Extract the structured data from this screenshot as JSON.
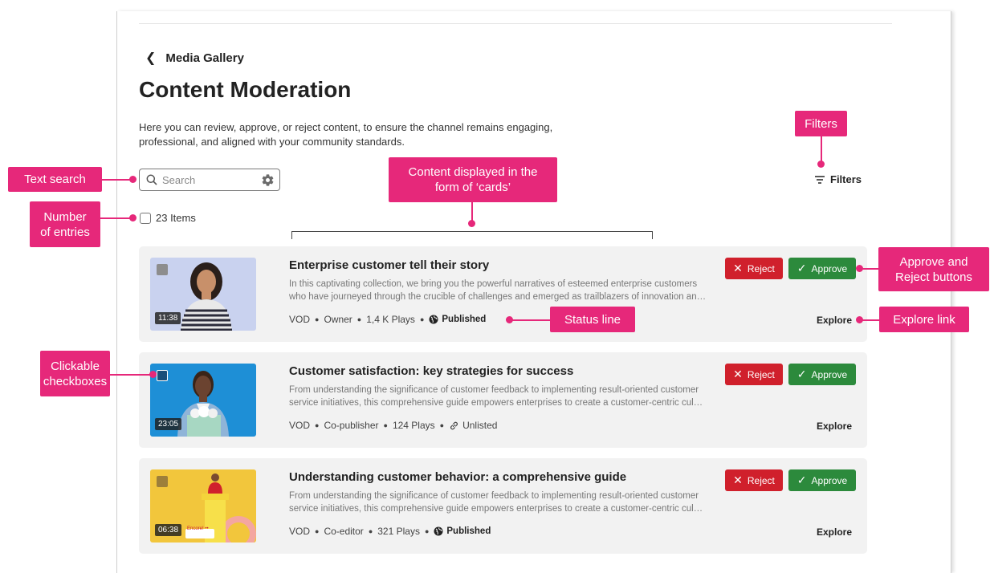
{
  "breadcrumb": {
    "back_icon": "chevron-left-icon",
    "label": "Media Gallery"
  },
  "page": {
    "title": "Content Moderation",
    "description": "Here you can review, approve, or reject content, to ensure the channel remains engaging, professional, and aligned with your community standards."
  },
  "search": {
    "placeholder": "Search",
    "icon": "search-icon",
    "settings_icon": "gear-icon"
  },
  "list": {
    "count_label": "23 Items"
  },
  "filters": {
    "label": "Filters",
    "icon": "filter-icon"
  },
  "cards": [
    {
      "title": "Enterprise customer tell their story",
      "desc_line1": "In this captivating collection, we bring you the powerful narratives of esteemed enterprise customers",
      "desc_line2": "who have journeyed through the crucible of challenges and emerged as trailblazers of innovation an…",
      "duration": "11:38",
      "type": "VOD",
      "role": "Owner",
      "plays": "1,4 K Plays",
      "status": "Published",
      "status_icon": "globe-icon",
      "reject_label": "Reject",
      "approve_label": "Approve",
      "explore_label": "Explore"
    },
    {
      "title": "Customer satisfaction: key strategies for success",
      "desc_line1": "From understanding the significance of customer feedback to implementing result-oriented customer",
      "desc_line2": "service initiatives, this comprehensive guide empowers enterprises to create a customer-centric cul…",
      "duration": "23:05",
      "type": "VOD",
      "role": "Co-publisher",
      "plays": "124 Plays",
      "status": "Unlisted",
      "status_icon": "link-icon",
      "reject_label": "Reject",
      "approve_label": "Approve",
      "explore_label": "Explore"
    },
    {
      "title": "Understanding customer behavior: a comprehensive guide",
      "desc_line1": "From understanding the significance of customer feedback to implementing result-oriented customer",
      "desc_line2": "service initiatives, this comprehensive guide empowers enterprises to create a customer-centric cul…",
      "duration": "06:38",
      "thumb_caption": "Encore! ••",
      "type": "VOD",
      "role": "Co-editor",
      "plays": "321 Plays",
      "status": "Published",
      "status_icon": "globe-icon",
      "reject_label": "Reject",
      "approve_label": "Approve",
      "explore_label": "Explore"
    }
  ],
  "annotations": {
    "text_search": "Text search",
    "number_of_entries": "Number of entries",
    "cards_form": "Content displayed in the form of ‘cards’",
    "filters": "Filters",
    "approve_reject": "Approve and Reject buttons",
    "status_line": "Status line",
    "explore_link": "Explore link",
    "clickable_checkboxes": "Clickable checkboxes"
  },
  "colors": {
    "accent": "#e6287a",
    "reject": "#d0202c",
    "approve": "#2c8a3c",
    "card_bg": "#f2f2f2"
  }
}
